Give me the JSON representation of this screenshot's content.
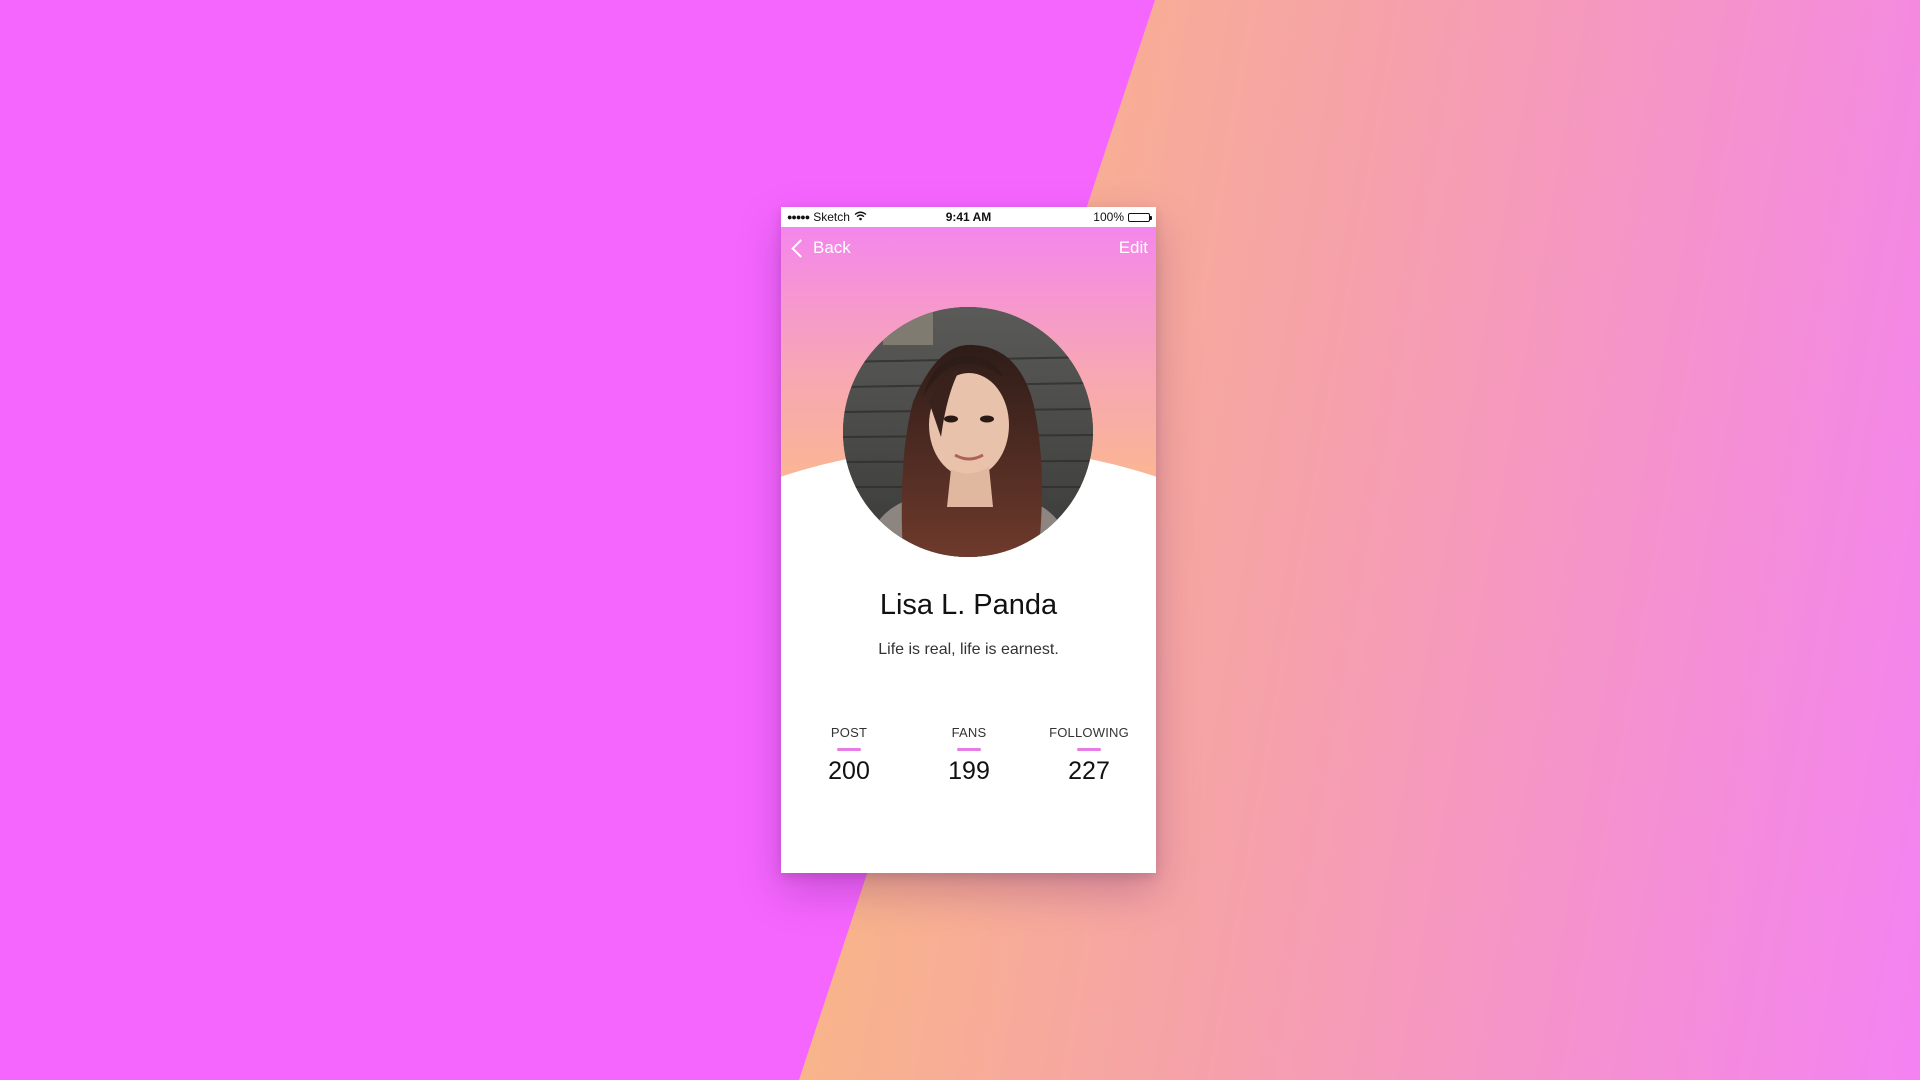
{
  "colors": {
    "accent": "#e87ce6",
    "background_magenta": "#f566fe",
    "background_yellow": "#ffe232",
    "hero_top": "#f482f4",
    "hero_bottom": "#fbb98a"
  },
  "status_bar": {
    "carrier": "Sketch",
    "signal_dots": "●●●●●",
    "wifi_icon": "wifi-icon",
    "time": "9:41 AM",
    "battery": "100%"
  },
  "nav": {
    "back_label": "Back",
    "back_icon": "chevron-left-icon",
    "edit_label": "Edit"
  },
  "profile": {
    "name": "Lisa L. Panda",
    "bio": "Life is real, life is earnest."
  },
  "stats": [
    {
      "label": "POST",
      "value": "200"
    },
    {
      "label": "FANS",
      "value": "199"
    },
    {
      "label": "FOLLOWING",
      "value": "227"
    }
  ]
}
